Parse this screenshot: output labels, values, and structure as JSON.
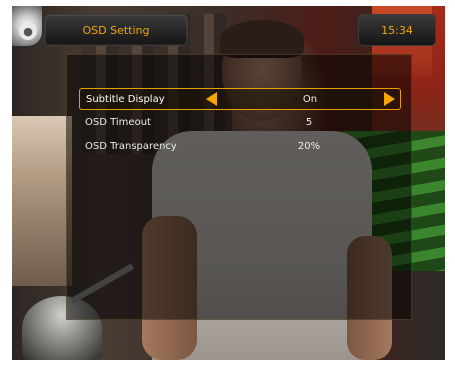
{
  "header": {
    "title": "OSD Setting",
    "clock": "15:34"
  },
  "menu": {
    "rows": [
      {
        "label": "Subtitle Display",
        "value": "On",
        "selected": true
      },
      {
        "label": "OSD Timeout",
        "value": "5",
        "selected": false
      },
      {
        "label": "OSD Transparency",
        "value": "20%",
        "selected": false
      }
    ]
  },
  "icons": {
    "globe": "globe-icon",
    "left": "arrow-left-icon",
    "right": "arrow-right-icon"
  },
  "colors": {
    "accent": "#f1a600",
    "panel": "#000000",
    "highlight_border": "#e8a000"
  }
}
